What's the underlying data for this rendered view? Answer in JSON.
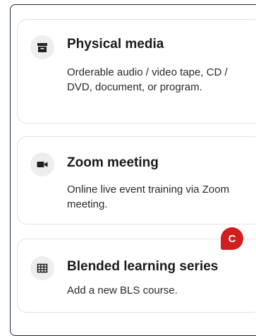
{
  "colors": {
    "panel_border": "#1f2b45",
    "card_border": "#e3e3e3",
    "icon_bg": "#eeeeee",
    "badge_bg": "#d11e1e"
  },
  "options": [
    {
      "title": "Physical media",
      "description": "Orderable audio / video tape, CD / DVD, document, or program.",
      "icon": "archive-box-icon"
    },
    {
      "title": "Zoom meeting",
      "description": "Online live event training via Zoom meeting.",
      "icon": "video-camera-icon"
    },
    {
      "title": "Blended learning series",
      "description": "Add a new BLS course.",
      "icon": "grid-table-icon"
    }
  ],
  "callout_badge": {
    "label": "C"
  }
}
